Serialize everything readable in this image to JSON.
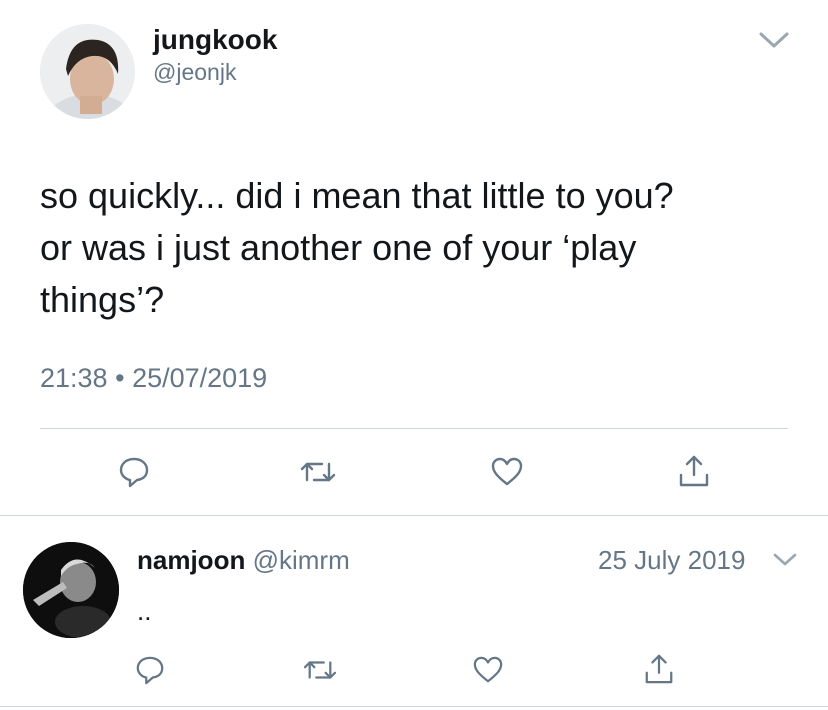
{
  "main_tweet": {
    "display_name": "jungkook",
    "handle": "@jeonjk",
    "lines": [
      "so quickly... did i mean that little to you?",
      "or was i just another one of your ‘play",
      "things’?"
    ],
    "time": "21:38",
    "separator": "•",
    "date": "25/07/2019",
    "menu_icon": "chevron-down-icon",
    "actions": [
      "reply-icon",
      "retweet-icon",
      "like-icon",
      "share-icon"
    ]
  },
  "reply_tweet": {
    "display_name": "namjoon",
    "handle": "@kimrm",
    "date": "25 July 2019",
    "text": "..",
    "menu_icon": "chevron-down-icon",
    "actions": [
      "reply-icon",
      "retweet-icon",
      "like-icon",
      "share-icon"
    ]
  },
  "colors": {
    "text": "#14171a",
    "muted": "#657786",
    "divider": "#cfd7dd",
    "icon": "#657786"
  }
}
